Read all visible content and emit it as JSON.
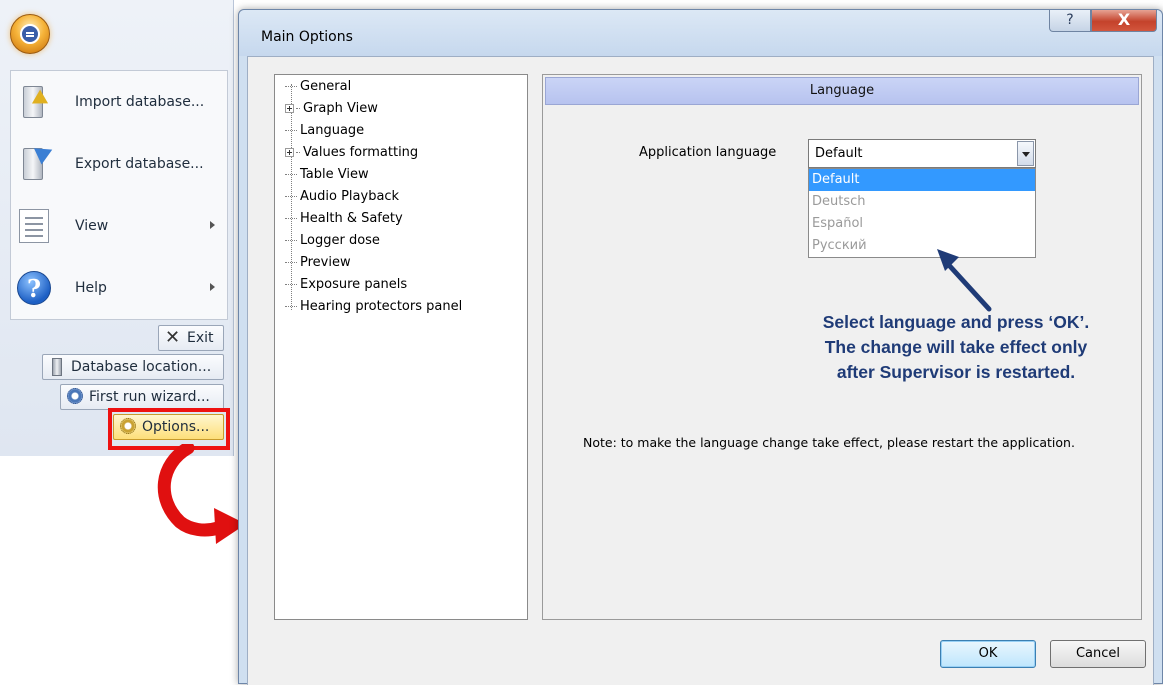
{
  "app_menu": {
    "items": [
      {
        "label": "Import database...",
        "icon": "import-database-icon"
      },
      {
        "label": "Export database...",
        "icon": "export-database-icon"
      },
      {
        "label": "View",
        "icon": "view-icon"
      },
      {
        "label": "Help",
        "icon": "help-icon"
      }
    ],
    "footer_buttons": {
      "exit": "Exit",
      "database_location": "Database location...",
      "first_run_wizard": "First run wizard...",
      "options": "Options..."
    },
    "highlight_color": "#ee1111"
  },
  "dialog": {
    "title": "Main Options",
    "help_glyph": "?",
    "close_glyph": "X",
    "tree": [
      {
        "label": "General",
        "expandable": false
      },
      {
        "label": "Graph View",
        "expandable": true
      },
      {
        "label": "Language",
        "expandable": false
      },
      {
        "label": "Values formatting",
        "expandable": true
      },
      {
        "label": "Table View",
        "expandable": false
      },
      {
        "label": "Audio Playback",
        "expandable": false
      },
      {
        "label": "Health & Safety",
        "expandable": false
      },
      {
        "label": "Logger dose",
        "expandable": false
      },
      {
        "label": "Preview",
        "expandable": false
      },
      {
        "label": "Exposure panels",
        "expandable": false
      },
      {
        "label": "Hearing protectors panel",
        "expandable": false
      }
    ],
    "panel": {
      "header": "Language",
      "language_label": "Application language",
      "language_value": "Default",
      "language_options": [
        "Default",
        "Deutsch",
        "Español",
        "Русский"
      ],
      "selected_option": "Default",
      "annotation_lines": [
        "Select language and press ‘OK’.",
        "The change will take effect only",
        "after Supervisor is restarted."
      ],
      "note": "Note: to make the language change take effect, please restart the application."
    },
    "buttons": {
      "ok": "OK",
      "cancel": "Cancel"
    }
  }
}
